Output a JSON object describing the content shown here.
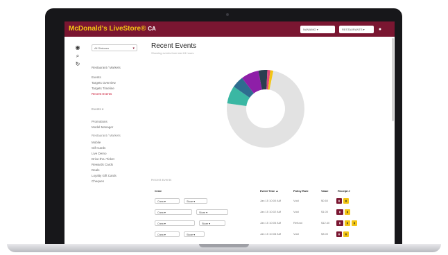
{
  "app": {
    "brand": "McDonald's LiveStore®",
    "brand_region": "CA"
  },
  "topbar": {
    "select1": "NANAIMO ▾",
    "select2": "RESTAURANTS ▾"
  },
  "sidebar": {
    "status": "All Statuses"
  },
  "nav": {
    "items": [
      "Restaurant / Markets",
      "Events",
      "Targets Overview",
      "Targets Timeline",
      "Recent Events",
      "Events ▾",
      "Promotions",
      "Model Manager"
    ],
    "head1": "Restaurant / Markets",
    "items2": [
      "Mobile",
      "Gift Cards",
      "Live Demo",
      "Drive-thru Ticket",
      "Rewards Cards",
      "Deals",
      "Loyalty Gift Cards",
      "Cheques"
    ]
  },
  "main": {
    "title": "Recent Events",
    "subtitle": "Showing events from last 24 hours",
    "section_label": "Recent Events",
    "columns": [
      "Crew",
      "Event Time ▲",
      "Policy Rule",
      "Value",
      "Receipt #"
    ]
  },
  "rows": [
    {
      "c1": "Crew ▾",
      "c2": "Store ▾",
      "time": "Jan 15 10:00 AM",
      "rule": "Void",
      "value": "$0.60"
    },
    {
      "c1": "Crew ▾",
      "c2": "Store ▾",
      "time": "Jan 15 10:02 AM",
      "rule": "Void",
      "value": "$1.00"
    },
    {
      "c1": "Crew ▾",
      "c2": "Store ▾",
      "time": "Jan 15 10:05 AM",
      "rule": "Refund",
      "value": "$12.40"
    },
    {
      "c1": "Crew ▾",
      "c2": "Store ▾",
      "time": "Jan 15 10:08 AM",
      "rule": "Void",
      "value": "$3.00"
    }
  ],
  "chart_data": {
    "type": "pie",
    "slices": [
      {
        "value": 60,
        "color": "#e2e2e2"
      },
      {
        "value": 6,
        "color": "#3ab7a3"
      },
      {
        "value": 4,
        "color": "#2e6d8f"
      },
      {
        "value": 6,
        "color": "#8e1fa8"
      },
      {
        "value": 3,
        "color": "#2c3e50"
      },
      {
        "value": 1,
        "color": "#e0457b"
      },
      {
        "value": 1,
        "color": "#f3c514"
      }
    ]
  }
}
